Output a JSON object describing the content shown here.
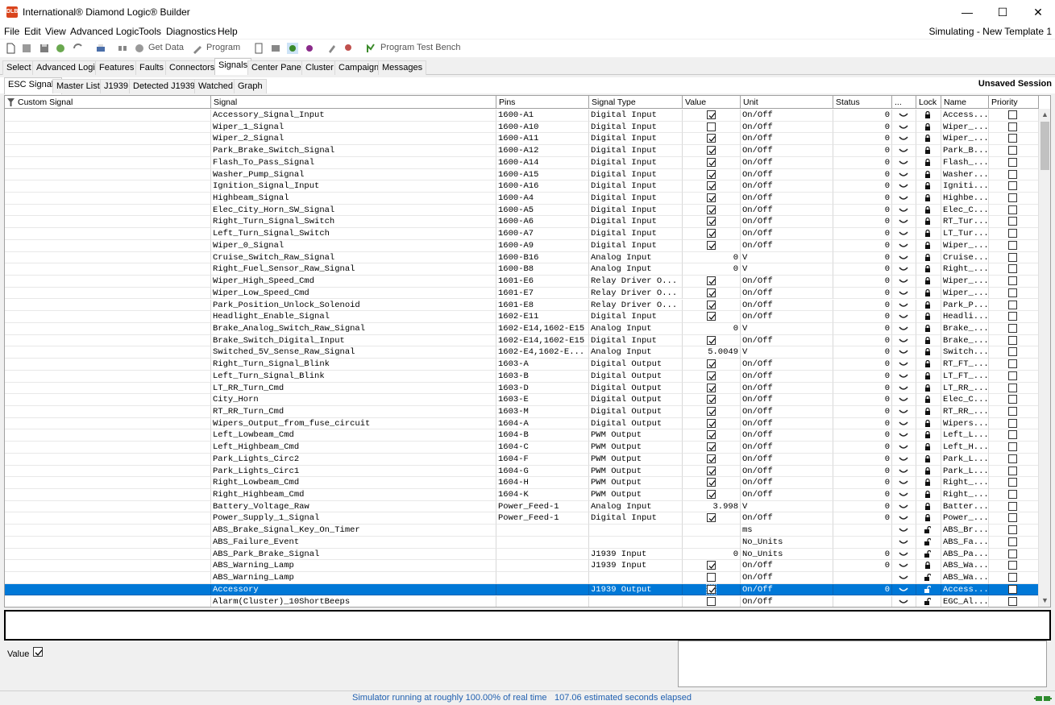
{
  "window": {
    "title": "International® Diamond Logic® Builder",
    "app_icon_text": "DLB",
    "minimize": "—",
    "maximize": "☐",
    "close": "✕"
  },
  "menu": {
    "items": [
      "File",
      "Edit",
      "View",
      "Advanced Logic",
      "Tools",
      "Diagnostics",
      "Help"
    ],
    "status_right": "Simulating - New Template 1"
  },
  "toolbar": {
    "get_data": "Get Data",
    "program": "Program",
    "program_test_bench": "Program Test Bench"
  },
  "main_tabs": [
    "Select",
    "Advanced Logic",
    "Features",
    "Faults",
    "Connectors",
    "Signals",
    "Center Panel",
    "Cluster",
    "Campaign",
    "Messages"
  ],
  "main_tab_active": 5,
  "sub_tabs": [
    "ESC Signals",
    "Master List",
    "J1939",
    "Detected J1939",
    "Watched",
    "Graph"
  ],
  "sub_tab_active": 0,
  "session_status": "Unsaved Session",
  "table": {
    "columns": [
      "Custom Signal",
      "Signal",
      "Pins",
      "Signal Type",
      "Value",
      "Unit",
      "Status",
      "...",
      "Lock",
      "Name",
      "Priority"
    ],
    "rows": [
      {
        "signal": "Accessory_Signal_Input",
        "pins": "1600-A1",
        "type": "Digital Input",
        "value": "chk",
        "unit": "On/Off",
        "status": "0",
        "lock": "locked",
        "name": "Access..."
      },
      {
        "signal": "Wiper_1_Signal",
        "pins": "1600-A10",
        "type": "Digital Input",
        "value": "unchk",
        "unit": "On/Off",
        "status": "0",
        "lock": "locked",
        "name": "Wiper_..."
      },
      {
        "signal": "Wiper_2_Signal",
        "pins": "1600-A11",
        "type": "Digital Input",
        "value": "chk",
        "unit": "On/Off",
        "status": "0",
        "lock": "locked",
        "name": "Wiper_..."
      },
      {
        "signal": "Park_Brake_Switch_Signal",
        "pins": "1600-A12",
        "type": "Digital Input",
        "value": "chk",
        "unit": "On/Off",
        "status": "0",
        "lock": "locked",
        "name": "Park_B..."
      },
      {
        "signal": "Flash_To_Pass_Signal",
        "pins": "1600-A14",
        "type": "Digital Input",
        "value": "chk",
        "unit": "On/Off",
        "status": "0",
        "lock": "locked",
        "name": "Flash_..."
      },
      {
        "signal": "Washer_Pump_Signal",
        "pins": "1600-A15",
        "type": "Digital Input",
        "value": "chk",
        "unit": "On/Off",
        "status": "0",
        "lock": "locked",
        "name": "Washer..."
      },
      {
        "signal": "Ignition_Signal_Input",
        "pins": "1600-A16",
        "type": "Digital Input",
        "value": "chk",
        "unit": "On/Off",
        "status": "0",
        "lock": "locked",
        "name": "Igniti..."
      },
      {
        "signal": "Highbeam_Signal",
        "pins": "1600-A4",
        "type": "Digital Input",
        "value": "chk",
        "unit": "On/Off",
        "status": "0",
        "lock": "locked",
        "name": "Highbe..."
      },
      {
        "signal": "Elec_City_Horn_SW_Signal",
        "pins": "1600-A5",
        "type": "Digital Input",
        "value": "chk",
        "unit": "On/Off",
        "status": "0",
        "lock": "locked",
        "name": "Elec_C..."
      },
      {
        "signal": "Right_Turn_Signal_Switch",
        "pins": "1600-A6",
        "type": "Digital Input",
        "value": "chk",
        "unit": "On/Off",
        "status": "0",
        "lock": "locked",
        "name": "RT_Tur..."
      },
      {
        "signal": "Left_Turn_Signal_Switch",
        "pins": "1600-A7",
        "type": "Digital Input",
        "value": "chk",
        "unit": "On/Off",
        "status": "0",
        "lock": "locked",
        "name": "LT_Tur..."
      },
      {
        "signal": "Wiper_0_Signal",
        "pins": "1600-A9",
        "type": "Digital Input",
        "value": "chk",
        "unit": "On/Off",
        "status": "0",
        "lock": "locked",
        "name": "Wiper_..."
      },
      {
        "signal": "Cruise_Switch_Raw_Signal",
        "pins": "1600-B16",
        "type": "Analog Input",
        "value": "0",
        "unit": "V",
        "status": "0",
        "lock": "locked",
        "name": "Cruise..."
      },
      {
        "signal": "Right_Fuel_Sensor_Raw_Signal",
        "pins": "1600-B8",
        "type": "Analog Input",
        "value": "0",
        "unit": "V",
        "status": "0",
        "lock": "locked",
        "name": "Right_..."
      },
      {
        "signal": "Wiper_High_Speed_Cmd",
        "pins": "1601-E6",
        "type": "Relay Driver O...",
        "value": "chk",
        "unit": "On/Off",
        "status": "0",
        "lock": "locked",
        "name": "Wiper_..."
      },
      {
        "signal": "Wiper_Low_Speed_Cmd",
        "pins": "1601-E7",
        "type": "Relay Driver O...",
        "value": "chk",
        "unit": "On/Off",
        "status": "0",
        "lock": "locked",
        "name": "Wiper_..."
      },
      {
        "signal": "Park_Position_Unlock_Solenoid",
        "pins": "1601-E8",
        "type": "Relay Driver O...",
        "value": "chk",
        "unit": "On/Off",
        "status": "0",
        "lock": "locked",
        "name": "Park_P..."
      },
      {
        "signal": "Headlight_Enable_Signal",
        "pins": "1602-E11",
        "type": "Digital Input",
        "value": "chk",
        "unit": "On/Off",
        "status": "0",
        "lock": "locked",
        "name": "Headli..."
      },
      {
        "signal": "Brake_Analog_Switch_Raw_Signal",
        "pins": "1602-E14,1602-E15",
        "type": "Analog Input",
        "value": "0",
        "unit": "V",
        "status": "0",
        "lock": "locked",
        "name": "Brake_..."
      },
      {
        "signal": "Brake_Switch_Digital_Input",
        "pins": "1602-E14,1602-E15",
        "type": "Digital Input",
        "value": "chk",
        "unit": "On/Off",
        "status": "0",
        "lock": "locked",
        "name": "Brake_..."
      },
      {
        "signal": "Switched_5V_Sense_Raw_Signal",
        "pins": "1602-E4,1602-E...",
        "type": "Analog Input",
        "value": "5.0049",
        "unit": "V",
        "status": "0",
        "lock": "locked",
        "name": "Switch..."
      },
      {
        "signal": "Right_Turn_Signal_Blink",
        "pins": "1603-A",
        "type": "Digital Output",
        "value": "chk",
        "unit": "On/Off",
        "status": "0",
        "lock": "locked",
        "name": "RT_FT_..."
      },
      {
        "signal": "Left_Turn_Signal_Blink",
        "pins": "1603-B",
        "type": "Digital Output",
        "value": "chk",
        "unit": "On/Off",
        "status": "0",
        "lock": "locked",
        "name": "LT_FT_..."
      },
      {
        "signal": "LT_RR_Turn_Cmd",
        "pins": "1603-D",
        "type": "Digital Output",
        "value": "chk",
        "unit": "On/Off",
        "status": "0",
        "lock": "locked",
        "name": "LT_RR_..."
      },
      {
        "signal": "City_Horn",
        "pins": "1603-E",
        "type": "Digital Output",
        "value": "chk",
        "unit": "On/Off",
        "status": "0",
        "lock": "locked",
        "name": "Elec_C..."
      },
      {
        "signal": "RT_RR_Turn_Cmd",
        "pins": "1603-M",
        "type": "Digital Output",
        "value": "chk",
        "unit": "On/Off",
        "status": "0",
        "lock": "locked",
        "name": "RT_RR_..."
      },
      {
        "signal": "Wipers_Output_from_fuse_circuit",
        "pins": "1604-A",
        "type": "Digital Output",
        "value": "chk",
        "unit": "On/Off",
        "status": "0",
        "lock": "locked",
        "name": "Wipers..."
      },
      {
        "signal": "Left_Lowbeam_Cmd",
        "pins": "1604-B",
        "type": "PWM Output",
        "value": "chk",
        "unit": "On/Off",
        "status": "0",
        "lock": "locked",
        "name": "Left_L..."
      },
      {
        "signal": "Left_Highbeam_Cmd",
        "pins": "1604-C",
        "type": "PWM Output",
        "value": "chk",
        "unit": "On/Off",
        "status": "0",
        "lock": "locked",
        "name": "Left_H..."
      },
      {
        "signal": "Park_Lights_Circ2",
        "pins": "1604-F",
        "type": "PWM Output",
        "value": "chk",
        "unit": "On/Off",
        "status": "0",
        "lock": "locked",
        "name": "Park_L..."
      },
      {
        "signal": "Park_Lights_Circ1",
        "pins": "1604-G",
        "type": "PWM Output",
        "value": "chk",
        "unit": "On/Off",
        "status": "0",
        "lock": "locked",
        "name": "Park_L..."
      },
      {
        "signal": "Right_Lowbeam_Cmd",
        "pins": "1604-H",
        "type": "PWM Output",
        "value": "chk",
        "unit": "On/Off",
        "status": "0",
        "lock": "locked",
        "name": "Right_..."
      },
      {
        "signal": "Right_Highbeam_Cmd",
        "pins": "1604-K",
        "type": "PWM Output",
        "value": "chk",
        "unit": "On/Off",
        "status": "0",
        "lock": "locked",
        "name": "Right_..."
      },
      {
        "signal": "Battery_Voltage_Raw",
        "pins": "Power_Feed-1",
        "type": "Analog Input",
        "value": "3.998",
        "unit": "V",
        "status": "0",
        "lock": "locked",
        "name": "Batter..."
      },
      {
        "signal": "Power_Supply_1_Signal",
        "pins": "Power_Feed-1",
        "type": "Digital Input",
        "value": "chk",
        "unit": "On/Off",
        "status": "0",
        "lock": "locked",
        "name": "Power_..."
      },
      {
        "signal": "ABS_Brake_Signal_Key_On_Timer",
        "pins": "",
        "type": "",
        "value": "",
        "unit": "ms",
        "status": "",
        "lock": "unlocked",
        "name": "ABS_Br..."
      },
      {
        "signal": "ABS_Failure_Event",
        "pins": "",
        "type": "",
        "value": "",
        "unit": "No_Units",
        "status": "",
        "lock": "unlocked",
        "name": "ABS_Fa..."
      },
      {
        "signal": "ABS_Park_Brake_Signal",
        "pins": "",
        "type": "J1939 Input",
        "value": "0",
        "unit": "No_Units",
        "status": "0",
        "lock": "unlocked",
        "name": "ABS_Pa..."
      },
      {
        "signal": "ABS_Warning_Lamp",
        "pins": "",
        "type": "J1939 Input",
        "value": "chk",
        "unit": "On/Off",
        "status": "0",
        "lock": "locked",
        "name": "ABS_Wa..."
      },
      {
        "signal": "ABS_Warning_Lamp",
        "pins": "",
        "type": "",
        "value": "unchk",
        "unit": "On/Off",
        "status": "",
        "lock": "unlocked",
        "name": "ABS_Wa..."
      },
      {
        "signal": "Accessory",
        "pins": "",
        "type": "J1939 Output",
        "value": "chk",
        "unit": "On/Off",
        "status": "0",
        "lock": "unlocked",
        "name": "Access...",
        "selected": true
      },
      {
        "signal": "Alarm(Cluster)_10ShortBeeps",
        "pins": "",
        "type": "",
        "value": "unchk",
        "unit": "On/Off",
        "status": "",
        "lock": "unlocked",
        "name": "EGC_Al..."
      }
    ]
  },
  "value_panel": {
    "label": "Value"
  },
  "status_bar": {
    "sim_rate": "Simulator running at roughly 100.00% of real time",
    "elapsed": "107.06 estimated seconds elapsed"
  },
  "colors": {
    "selection": "#0078d7",
    "status_text": "#2060b0",
    "app_icon": "#d9441c"
  }
}
